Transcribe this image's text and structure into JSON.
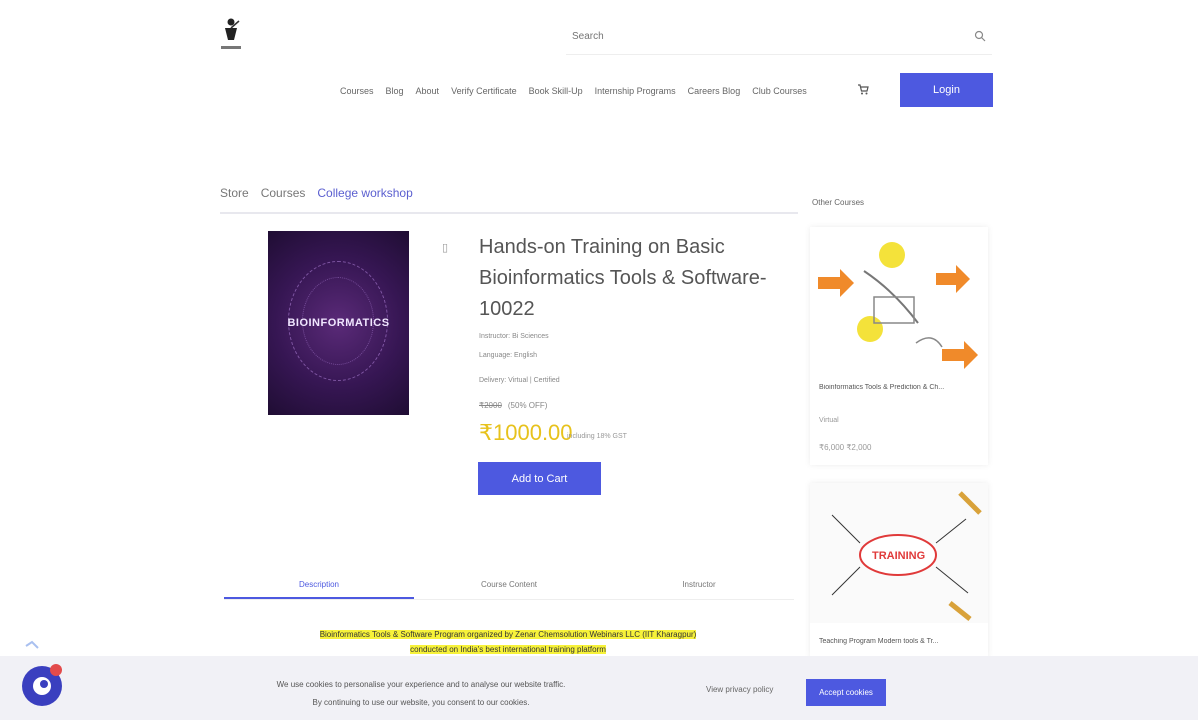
{
  "header": {
    "search_placeholder": "Search",
    "nav": [
      "Courses",
      "Blog",
      "About",
      "Verify Certificate",
      "Book Skill-Up",
      "Internship Programs",
      "Careers Blog",
      "Club Courses"
    ],
    "login_label": "Login"
  },
  "breadcrumb": [
    "Store",
    "Courses",
    "College workshop"
  ],
  "product": {
    "title": "Hands-on Training on Basic Bioinformatics Tools & Software-10022",
    "image_text": "BIOINFORMATICS",
    "meta_lines": [
      "Instructor: Bi Sciences",
      "Language: English",
      "Delivery: Virtual | Certified"
    ],
    "old_price": "₹2000",
    "discount": "(50% OFF)",
    "price": "₹1000.00",
    "price_note": "including 18% GST",
    "add_to_cart_label": "Add to Cart"
  },
  "tabs": [
    "Description",
    "Course Content",
    "Instructor"
  ],
  "description": {
    "line1": "Bioinformatics Tools & Software Program organized by Zenar Chemsolution Webinars LLC (IIT Kharagpur)",
    "line2": "conducted on India's best international training platform"
  },
  "sidebar": {
    "title": "Other Courses",
    "cards": [
      {
        "name": "Bioinformatics Tools & Prediction & Ch...",
        "mode": "Virtual",
        "price": "₹6,000 ₹2,000"
      },
      {
        "name": "Teaching Program Modern tools & Tr..."
      }
    ]
  },
  "cookie": {
    "line1": "We use cookies to personalise your experience and to analyse our website traffic.",
    "line2": "By continuing to use our website, you consent to our cookies.",
    "view_policy": "View privacy policy",
    "accept": "Accept cookies"
  },
  "colors": {
    "accent": "#4d59e0",
    "price": "#e7c21c",
    "highlight": "#f7f23a"
  }
}
